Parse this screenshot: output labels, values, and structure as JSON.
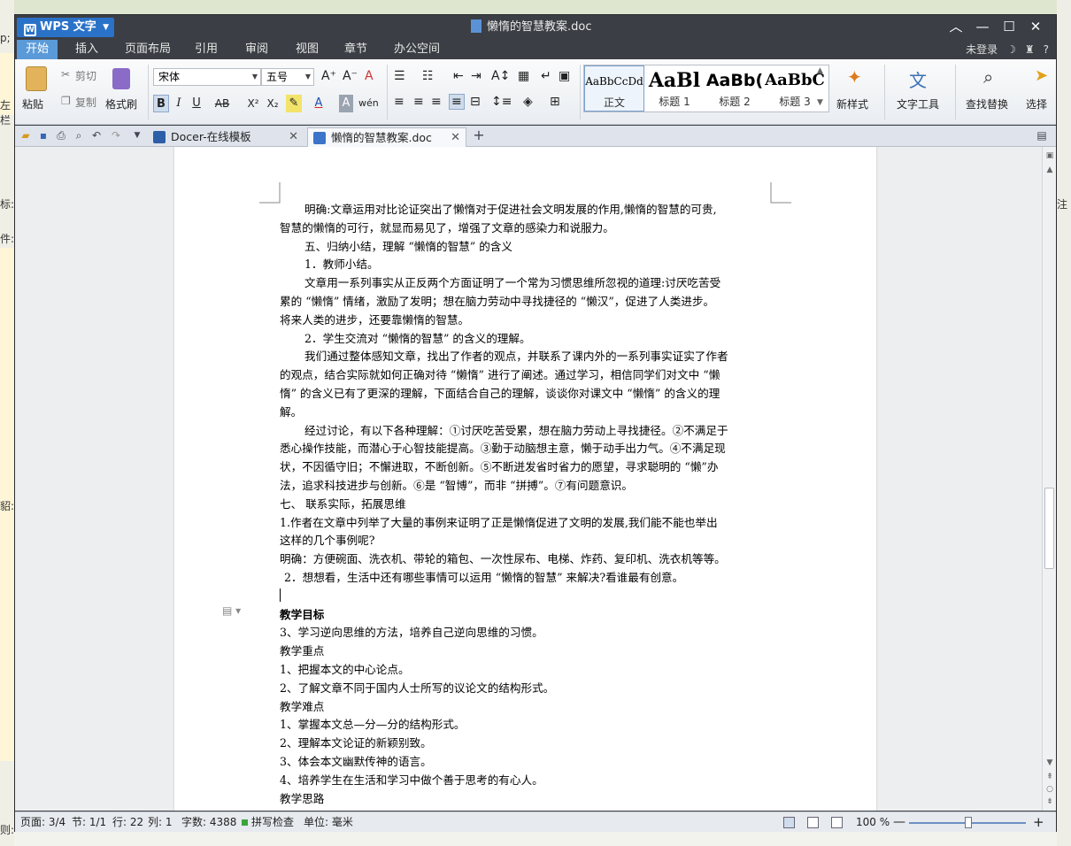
{
  "app": {
    "name": "WPS 文字",
    "document_title": "懒惰的智慧教案.doc"
  },
  "menu": {
    "tabs": [
      "开始",
      "插入",
      "页面布局",
      "引用",
      "审阅",
      "视图",
      "章节",
      "办公空间"
    ],
    "active_tab": "开始",
    "login": "未登录",
    "help": "?"
  },
  "ribbon": {
    "paste": "粘贴",
    "cut": "剪切",
    "copy": "复制",
    "format_painter": "格式刷",
    "font_name": "宋体",
    "font_size": "五号",
    "bold": "B",
    "italic": "I",
    "underline": "U",
    "strikethrough": "AB",
    "superscript": "X²",
    "subscript": "X₂",
    "font_color": "A",
    "styles": [
      {
        "preview": "AaBbCcDd",
        "name": "正文"
      },
      {
        "preview": "AaBl",
        "name": "标题 1"
      },
      {
        "preview": "AaBb(",
        "name": "标题 2"
      },
      {
        "preview": "AaBbC",
        "name": "标题 3"
      }
    ],
    "new_style": "新样式",
    "text_tools": "文字工具",
    "find_replace": "查找替换",
    "select": "选择"
  },
  "doc_tabs": [
    {
      "label": "Docer-在线模板",
      "active": false
    },
    {
      "label": "懒惰的智慧教案.doc",
      "active": true
    }
  ],
  "document": {
    "paragraphs": [
      {
        "text": "明确:文章运用对比论证突出了懒惰对于促进社会文明发展的作用,懒惰的智慧的可贵,",
        "style": "ind"
      },
      {
        "text": "智慧的懒惰的可行，就显而易见了，增强了文章的感染力和说服力。",
        "style": ""
      },
      {
        "text": "五、归纳小结，理解 “懒惰的智慧” 的含义",
        "style": "ind"
      },
      {
        "text": "1．教师小结。",
        "style": "ind"
      },
      {
        "text": "文章用一系列事实从正反两个方面证明了一个常为习惯思维所忽视的道理:讨厌吃苦受",
        "style": "ind"
      },
      {
        "text": "累的 “懒惰” 情绪，激励了发明；想在脑力劳动中寻找捷径的 “懒汉”，促进了人类进步。",
        "style": ""
      },
      {
        "text": "将来人类的进步，还要靠懒惰的智慧。",
        "style": ""
      },
      {
        "text": "2．学生交流对 “懒惰的智慧” 的含义的理解。",
        "style": "ind"
      },
      {
        "text": "我们通过整体感知文章，找出了作者的观点，并联系了课内外的一系列事实证实了作者",
        "style": "ind"
      },
      {
        "text": "的观点，结合实际就如何正确对待 “懒惰” 进行了阐述。通过学习，相信同学们对文中 “懒",
        "style": ""
      },
      {
        "text": "惰” 的含义已有了更深的理解，下面结合自己的理解，谈谈你对课文中 “懒惰” 的含义的理",
        "style": ""
      },
      {
        "text": "解。",
        "style": ""
      },
      {
        "text": "经过讨论，有以下各种理解：①讨厌吃苦受累，想在脑力劳动上寻找捷径。②不满足于",
        "style": "ind"
      },
      {
        "text": "悉心操作技能，而潜心于心智技能提高。③勤于动脑想主意，懒于动手出力气。④不满足现",
        "style": ""
      },
      {
        "text": "状，不因循守旧；不懈进取，不断创新。⑤不断迸发省时省力的愿望，寻求聪明的 “懒”办",
        "style": ""
      },
      {
        "text": "法，追求科技进步与创新。⑥是 “智博”，而非 “拼搏”。⑦有问题意识。",
        "style": ""
      },
      {
        "text": "七、 联系实际，拓展思维",
        "style": ""
      },
      {
        "text": "1.作者在文章中列举了大量的事例来证明了正是懒惰促进了文明的发展,我们能不能也举出",
        "style": ""
      },
      {
        "text": "这样的几个事例呢?",
        "style": ""
      },
      {
        "text": "明确：方便碗面、洗衣机、带轮的箱包、一次性尿布、电梯、炸药、复印机、洗衣机等等。",
        "style": ""
      },
      {
        "text": "2．想想看，生活中还有哪些事情可以运用 “懒惰的智慧” 来解决?看谁最有创意。",
        "style": "ind1"
      },
      {
        "text": "",
        "style": "cursor"
      },
      {
        "text": "教学目标",
        "style": "bold"
      },
      {
        "text": "3、学习逆向思维的方法，培养自己逆向思维的习惯。",
        "style": ""
      },
      {
        "text": "教学重点",
        "style": ""
      },
      {
        "text": "1、把握本文的中心论点。",
        "style": ""
      },
      {
        "text": "2、了解文章不同于国内人士所写的议论文的结构形式。",
        "style": ""
      },
      {
        "text": "教学难点",
        "style": ""
      },
      {
        "text": "1、掌握本文总—分—分的结构形式。",
        "style": ""
      },
      {
        "text": "2、理解本文论证的新颖别致。",
        "style": ""
      },
      {
        "text": "3、体会本文幽默传神的语言。",
        "style": ""
      },
      {
        "text": "4、培养学生在生活和学习中做个善于思考的有心人。",
        "style": ""
      },
      {
        "text": "教学思路",
        "style": ""
      }
    ]
  },
  "status": {
    "page": "页面: 3/4",
    "section": "节: 1/1",
    "line": "行: 22",
    "column": "列: 1",
    "word_count": "字数: 4388",
    "spell_check": "拼写检查",
    "unit": "单位: 毫米",
    "zoom": "100 %",
    "zoom_level": 100
  },
  "desktop": {
    "left_fragments": [
      "p;",
      "左栏",
      "标:",
      "件:",
      "貂:",
      "则:"
    ],
    "right_fragments": [
      "注"
    ]
  },
  "colors": {
    "app_button": "#2a72c8",
    "active_menu_tab": "#5a9ad9",
    "titlebar": "#3b3e44"
  }
}
